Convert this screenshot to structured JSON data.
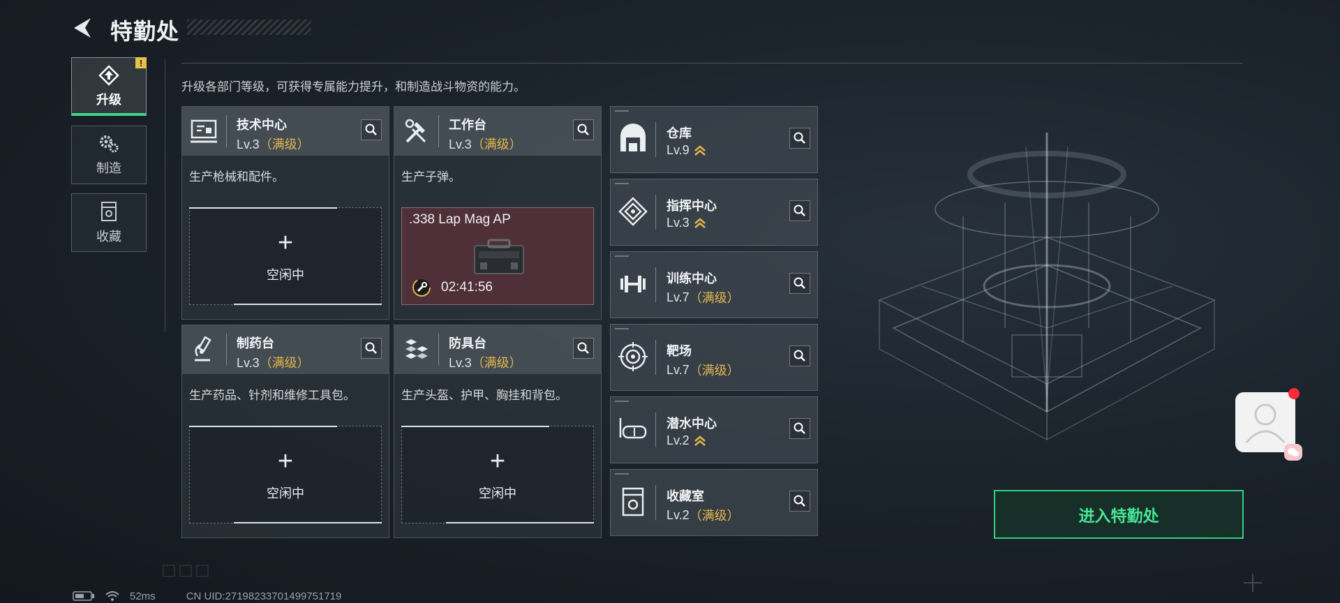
{
  "header": {
    "title": "特勤处",
    "back_icon": "back-arrow-icon"
  },
  "description": "升级各部门等级，可获得专属能力提升，和制造战斗物资的能力。",
  "side_tabs": [
    {
      "label": "升级",
      "icon": "upgrade-icon",
      "active": true,
      "badge": "!"
    },
    {
      "label": "制造",
      "icon": "gears-icon",
      "active": false
    },
    {
      "label": "收藏",
      "icon": "collection-icon",
      "active": false
    }
  ],
  "cards": [
    {
      "name": "技术中心",
      "level": "Lv.3",
      "status": "（满级）",
      "desc": "生产枪械和配件。",
      "icon": "tech-center-icon",
      "slot": {
        "type": "idle",
        "label": "空闲中"
      }
    },
    {
      "name": "工作台",
      "level": "Lv.3",
      "status": "（满级）",
      "desc": "生产子弹。",
      "icon": "workbench-icon",
      "slot": {
        "type": "producing",
        "item": ".338 Lap Mag AP",
        "timer": "02:41:56"
      }
    },
    {
      "name": "制药台",
      "level": "Lv.3",
      "status": "（满级）",
      "desc": "生产药品、针剂和维修工具包。",
      "icon": "pharmacy-icon",
      "slot": {
        "type": "idle",
        "label": "空闲中"
      }
    },
    {
      "name": "防具台",
      "level": "Lv.3",
      "status": "（满级）",
      "desc": "生产头盔、护甲、胸挂和背包。",
      "icon": "armor-bench-icon",
      "slot": {
        "type": "idle",
        "label": "空闲中"
      }
    }
  ],
  "departments": [
    {
      "name": "仓库",
      "level": "Lv.9",
      "status": "",
      "upgradable": true,
      "icon": "warehouse-icon"
    },
    {
      "name": "指挥中心",
      "level": "Lv.3",
      "status": "",
      "upgradable": true,
      "icon": "command-center-icon"
    },
    {
      "name": "训练中心",
      "level": "Lv.7",
      "status": "（满级）",
      "upgradable": false,
      "icon": "dumbbell-icon"
    },
    {
      "name": "靶场",
      "level": "Lv.7",
      "status": "（满级）",
      "upgradable": false,
      "icon": "target-icon"
    },
    {
      "name": "潜水中心",
      "level": "Lv.2",
      "status": "",
      "upgradable": true,
      "icon": "diving-goggles-icon"
    },
    {
      "name": "收藏室",
      "level": "Lv.2",
      "status": "（满级）",
      "upgradable": false,
      "icon": "collection-room-icon"
    }
  ],
  "enter_button": "进入特勤处",
  "status_bar": {
    "ping": "52ms",
    "uid": "CN UID:27198233701499751719"
  },
  "colors": {
    "accent": "#2fd27e",
    "maxed": "#e3b74c",
    "producing_bg": "#4f3038",
    "notify": "#ff2a3a"
  }
}
